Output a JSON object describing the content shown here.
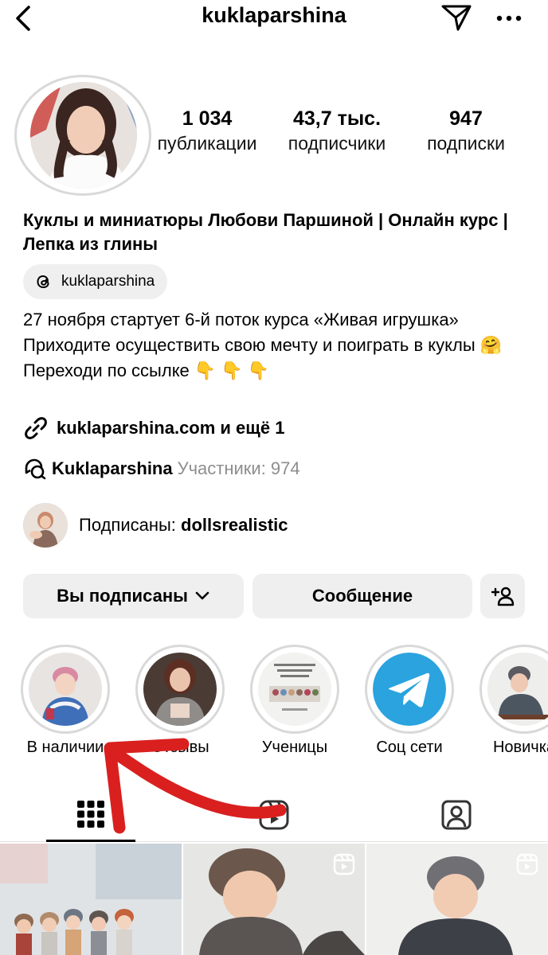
{
  "header": {
    "username": "kuklaparshina",
    "back_icon": "chevron-left-icon",
    "send_icon": "paper-plane-icon",
    "more_icon": "ellipsis-icon"
  },
  "stats": [
    {
      "value": "1 034",
      "label": "публикации"
    },
    {
      "value": "43,7 тыс.",
      "label": "подписчики"
    },
    {
      "value": "947",
      "label": "подписки"
    }
  ],
  "bio": {
    "name": "Куклы и миниатюры Любови Паршиной | Онлайн курс | Лепка из глины",
    "threads_handle": "kuklaparshina",
    "line1": "27 ноября стартует 6-й поток курса «Живая игрушка» Приходите осуществить свою мечту и поиграть в куклы 🤗",
    "line2": "Переходи по ссылке 👇 👇 👇",
    "link": "kuklaparshina.com и ещё 1",
    "community_name": "Kuklaparshina",
    "community_members": "Участники: 974",
    "followed_by_prefix": "Подписаны: ",
    "followed_by_user": "dollsrealistic"
  },
  "buttons": {
    "following": "Вы подписаны",
    "message": "Сообщение",
    "add_user_icon": "add-person-icon"
  },
  "highlights": [
    {
      "label": "В наличии"
    },
    {
      "label": "Отзывы"
    },
    {
      "label": "Ученицы"
    },
    {
      "label": "Соц сети"
    },
    {
      "label": "Новичка"
    }
  ],
  "tabs": [
    {
      "name": "posts",
      "icon": "grid-icon",
      "active": true
    },
    {
      "name": "reels",
      "icon": "reels-icon",
      "active": false
    },
    {
      "name": "tagged",
      "icon": "tagged-person-icon",
      "active": false
    }
  ],
  "colors": {
    "button_bg": "#efefef",
    "muted_text": "#8e8e8e",
    "annotation_arrow": "#d9201f",
    "telegram_blue": "#2aa3df"
  }
}
